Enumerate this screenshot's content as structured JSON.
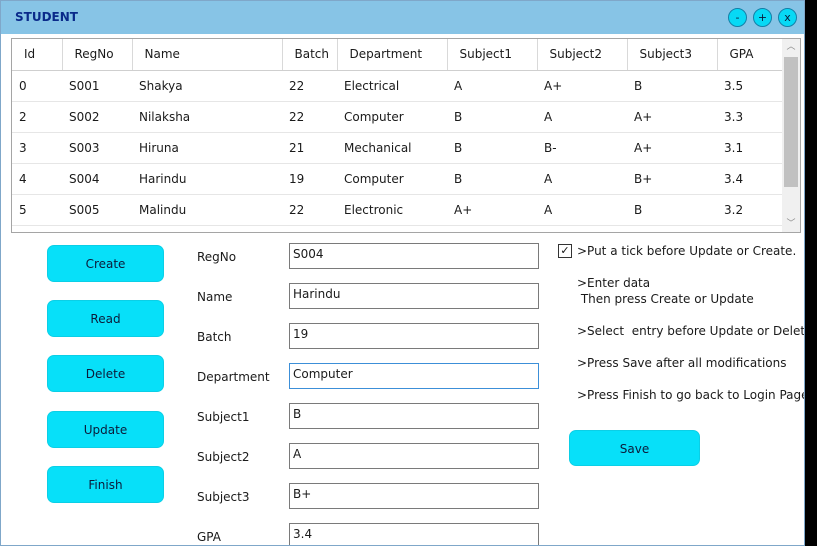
{
  "window": {
    "title": "STUDENT",
    "controls": {
      "minimize": "-",
      "maximize": "+",
      "close": "x"
    }
  },
  "grid": {
    "columns": [
      "Id",
      "RegNo",
      "Name",
      "Batch",
      "Department",
      "Subject1",
      "Subject2",
      "Subject3",
      "GPA"
    ],
    "rows": [
      [
        "0",
        "S001",
        "Shakya",
        "22",
        "Electrical",
        "A",
        "A+",
        "B",
        "3.5"
      ],
      [
        "2",
        "S002",
        "Nilaksha",
        "22",
        "Computer",
        "B",
        "A",
        "A+",
        "3.3"
      ],
      [
        "3",
        "S003",
        "Hiruna",
        "21",
        "Mechanical",
        "B",
        "B-",
        "A+",
        "3.1"
      ],
      [
        "4",
        "S004",
        "Harindu",
        "19",
        "Computer",
        "B",
        "A",
        "B+",
        "3.4"
      ],
      [
        "5",
        "S005",
        "Malindu",
        "22",
        "Electronic",
        "A+",
        "A",
        "B",
        "3.2"
      ]
    ],
    "scroll_up": "︿",
    "scroll_down": "﹀"
  },
  "buttons": {
    "create": "Create",
    "read": "Read",
    "delete": "Delete",
    "update": "Update",
    "finish": "Finish",
    "save": "Save"
  },
  "form": {
    "regno": {
      "label": "RegNo",
      "value": "S004"
    },
    "name": {
      "label": "Name",
      "value": "Harindu"
    },
    "batch": {
      "label": "Batch",
      "value": "19"
    },
    "department": {
      "label": "Department",
      "value": "Computer"
    },
    "subject1": {
      "label": "Subject1",
      "value": "B"
    },
    "subject2": {
      "label": "Subject2",
      "value": "A"
    },
    "subject3": {
      "label": "Subject3",
      "value": "B+"
    },
    "gpa": {
      "label": "GPA",
      "value": "3.4"
    }
  },
  "tick": {
    "checked": true,
    "mark": "✓"
  },
  "instructions": {
    "tick": ">Put a tick before Update or Create.",
    "enter_data": ">Enter data\n Then press Create or Update",
    "select": ">Select  entry before Update or Delete",
    "save": ">Press Save after all modifications",
    "finish": ">Press Finish to go back to Login Page"
  },
  "colors": {
    "titlebar": "#87c4e6",
    "title_text": "#0a2a8a",
    "button": "#07e0f9"
  }
}
